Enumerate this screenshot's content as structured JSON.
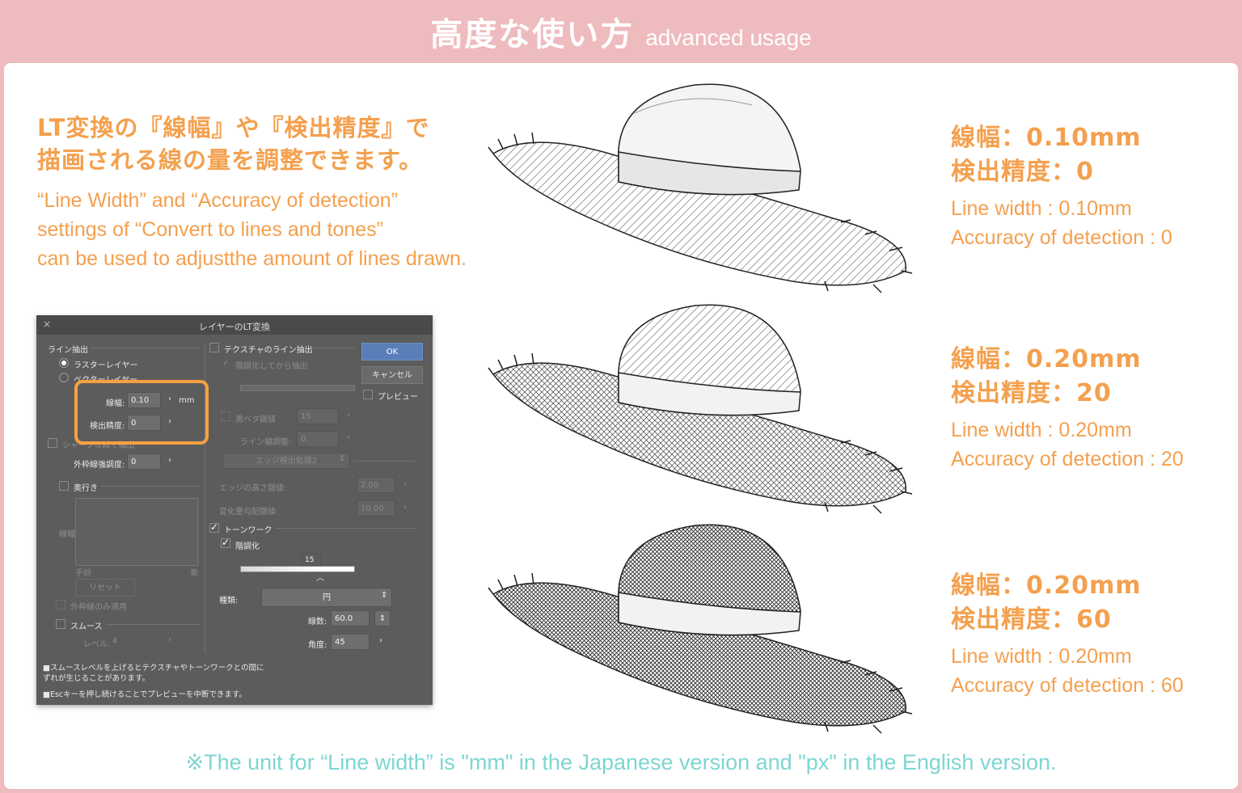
{
  "header": {
    "title_jp": "高度な使い方",
    "title_en": "advanced usage"
  },
  "intro": {
    "jp_line1": "LT変換の『線幅』や『検出精度』で",
    "jp_line2": "描画される線の量を調整できます。",
    "en_line1": "“Line Width” and “Accuracy of detection”",
    "en_line2": "settings of “Convert to lines and tones”",
    "en_line3": "can be used to adjustthe amount of lines drawn."
  },
  "dialog": {
    "title": "レイヤーのLT変換",
    "close": "×",
    "line_extraction": "ライン抽出",
    "raster_layer": "ラスターレイヤー",
    "vector_layer": "ベクターレイヤー",
    "line_width_label": "線幅:",
    "line_width_value": "0.10",
    "unit": "mm",
    "accuracy_label": "検出精度:",
    "accuracy_value": "0",
    "sharpness_label": "シャープな線で抽出",
    "outline_label": "外枠線強調度:",
    "outline_value": "0",
    "depth_label": "奥行き",
    "line_width_side": "線幅",
    "near": "手前",
    "far": "奥",
    "reset": "リセット",
    "apply_outline_only": "外枠線のみ適用",
    "smooth": "スムース",
    "level_label": "レベル:",
    "level_value": "4",
    "texture_line": "テクスチャのライン抽出",
    "after_posterize": "階調化してから抽出",
    "black_threshold_label": "黒ベタ閾値",
    "black_threshold_value": "15",
    "line_width_adjust_label": "ライン幅調整:",
    "line_width_adjust_value": "0",
    "edge_process": "エッジ検出処理2",
    "edge_height_label": "エッジの高さ閾値:",
    "edge_height_value": "2.00",
    "gradient_label": "変化量勾配閾値:",
    "gradient_value": "10.00",
    "tone_work": "トーンワーク",
    "posterize": "階調化",
    "slider_value": "15",
    "type_label": "種類:",
    "type_value": "円",
    "lines_label": "線数:",
    "lines_value": "60.0",
    "angle_label": "角度:",
    "angle_value": "45",
    "ok": "OK",
    "cancel": "キャンセル",
    "preview": "プレビュー",
    "note1": "■スムースレベルを上げるとテクスチャやトーンワークとの間に",
    "note1b": "ずれが生じることがあります。",
    "note2": "■Escキーを押し続けることでプレビューを中断できます。"
  },
  "examples": [
    {
      "jp_width": "線幅：0.10mm",
      "jp_accuracy": "検出精度：0",
      "en_width": "Line width : 0.10mm",
      "en_accuracy": "Accuracy of detection : 0"
    },
    {
      "jp_width": "線幅：0.20mm",
      "jp_accuracy": "検出精度：20",
      "en_width": "Line width : 0.20mm",
      "en_accuracy": "Accuracy of detection : 20"
    },
    {
      "jp_width": "線幅：0.20mm",
      "jp_accuracy": "検出精度：60",
      "en_width": "Line width : 0.20mm",
      "en_accuracy": "Accuracy of detection : 60"
    }
  ],
  "footnote": "※The unit for “Line width” is \"mm\" in the Japanese version and \"px\" in the English version.",
  "colors": {
    "header_bg": "#eebbbe",
    "accent_orange": "#f4a04e",
    "note_teal": "#7dd6d2",
    "dialog_bg": "#5c5c5c",
    "ok_blue": "#5a7fb8"
  }
}
